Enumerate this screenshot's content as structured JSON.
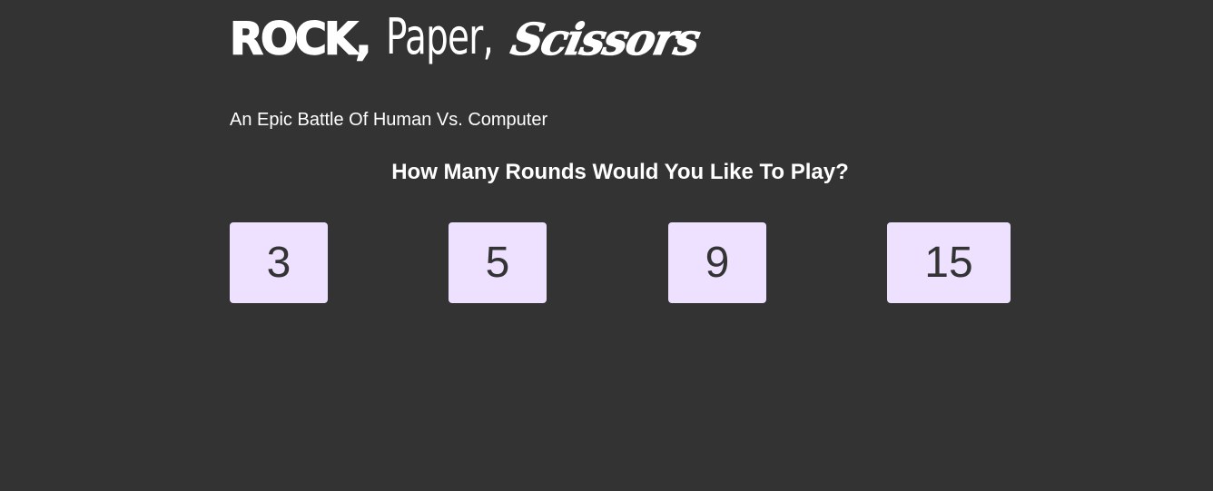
{
  "logo": {
    "rock": "ROCK,",
    "paper": "Paper,",
    "scissors": "Scissors"
  },
  "subtitle": "An Epic Battle Of Human Vs. Computer",
  "question": "How Many Rounds Would You Like To Play?",
  "rounds": {
    "option_1": "3",
    "option_2": "5",
    "option_3": "9",
    "option_4": "15"
  },
  "colors": {
    "background": "#333333",
    "text": "#ffffff",
    "button_background": "#ede1ff",
    "button_text": "#333333"
  }
}
